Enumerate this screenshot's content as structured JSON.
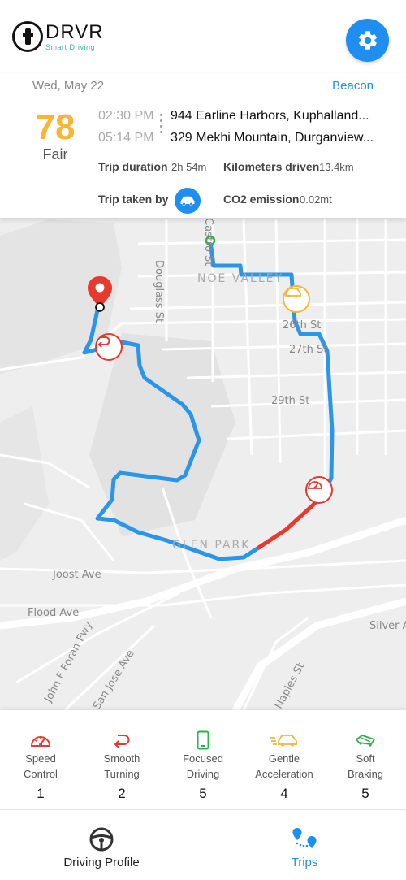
{
  "app": {
    "brand": "DRVR",
    "tagline": "Smart Driving"
  },
  "trip": {
    "date": "Wed, May 22",
    "device": "Beacon",
    "score": "78",
    "score_label": "Fair",
    "start_time": "02:30 PM",
    "end_time": "05:14 PM",
    "start_address": "944 Earline Harbors, Kuphalland...",
    "end_address": "329 Mekhi Mountain, Durganview...",
    "duration_label": "Trip duration",
    "duration_value": "2h 54m",
    "distance_label": "Kilometers driven",
    "distance_value": "13.4km",
    "taken_by_label": "Trip taken by",
    "taken_by_icon": "car-icon",
    "co2_label": "CO2 emission",
    "co2_value": "0.02mt"
  },
  "map": {
    "labels": {
      "douglass": "Douglass St",
      "castro": "Castro St",
      "noe_valley": "NOE VALLEY",
      "st26": "26th St",
      "st27": "27th St",
      "st29": "29th St",
      "glen_park": "GLEN PARK",
      "joost": "Joost Ave",
      "flood": "Flood Ave",
      "silver": "Silver A",
      "foran": "John F Foran Fwy",
      "san_jose": "San Jose Ave",
      "maples": "Naples St"
    },
    "route_color": "#2b95e8",
    "speeding_color": "#e8392e",
    "pin_color": "#e8392e"
  },
  "behaviors": [
    {
      "icon": "speedometer-icon",
      "label_line1": "Speed",
      "label_line2": "Control",
      "count": "1",
      "color": "#e8392e"
    },
    {
      "icon": "u-turn-icon",
      "label_line1": "Smooth",
      "label_line2": "Turning",
      "count": "2",
      "color": "#e8392e"
    },
    {
      "icon": "phone-icon",
      "label_line1": "Focused",
      "label_line2": "Driving",
      "count": "5",
      "color": "#2bb24c"
    },
    {
      "icon": "fast-car-icon",
      "label_line1": "Gentle",
      "label_line2": "Acceleration",
      "count": "4",
      "color": "#f7b733"
    },
    {
      "icon": "brake-car-icon",
      "label_line1": "Soft",
      "label_line2": "Braking",
      "count": "5",
      "color": "#2bb24c"
    }
  ],
  "nav": {
    "driving_profile": "Driving Profile",
    "trips": "Trips",
    "active_tab": "Trips"
  }
}
